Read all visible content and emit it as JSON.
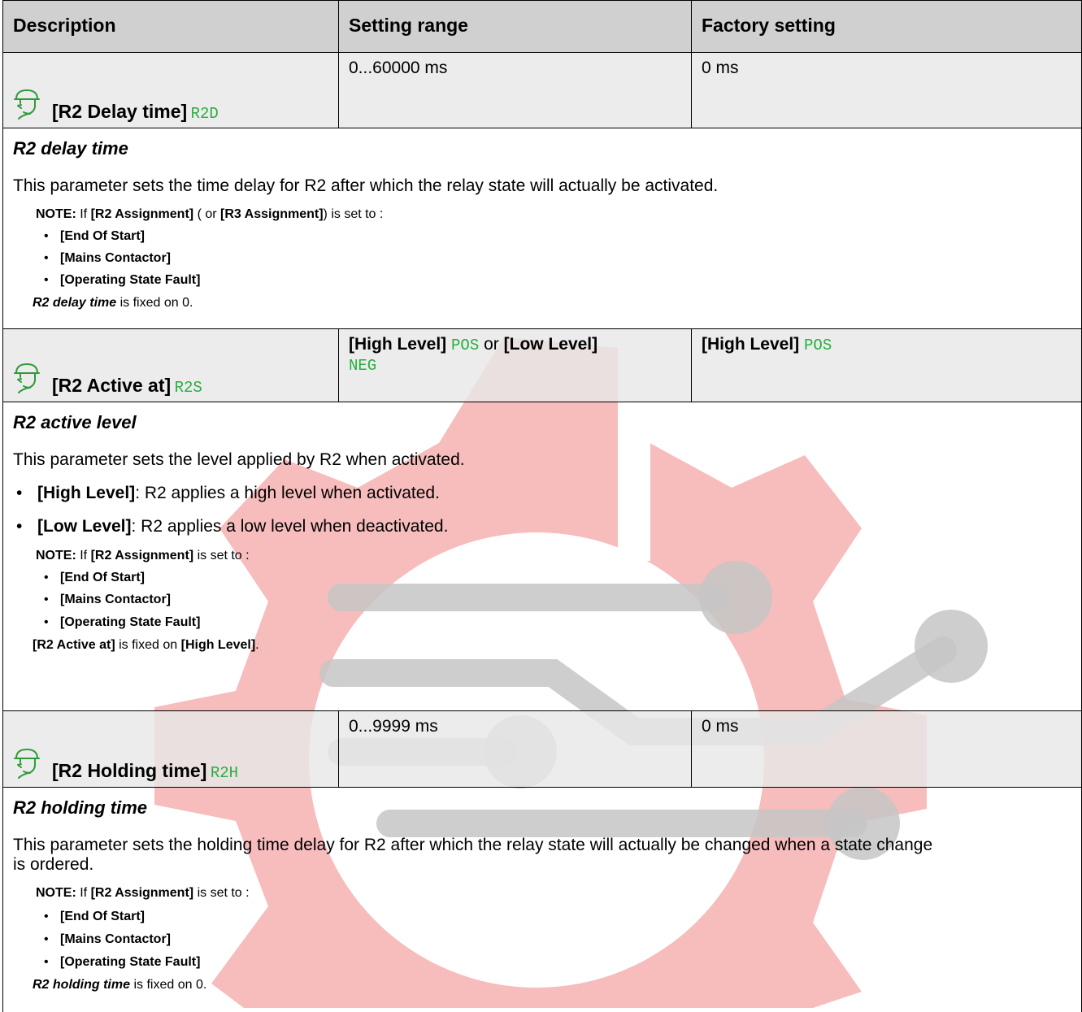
{
  "table": {
    "headers": [
      "Description",
      "Setting range",
      "Factory setting"
    ]
  },
  "params": [
    {
      "name": "[R2 Delay time]",
      "code": "R2D",
      "range": "0...60000 ms",
      "factory": "0 ms",
      "desc_title": "R2 delay time",
      "desc_text": "This parameter sets the time delay for R2 after which the relay state will actually be activated.",
      "note_label": "NOTE:",
      "note_if": "If",
      "note_a": "[R2 Assignment]",
      "note_mid": "( or",
      "note_b": "[R3 Assignment]",
      "note_end": ") is set to :",
      "note_items": [
        "[End Of Start]",
        "[Mains Contactor]",
        "[Operating State Fault]"
      ],
      "fixed_subject": "R2 delay time",
      "fixed_text": "is fixed on 0."
    },
    {
      "name": "[R2 Active at]",
      "code": "R2S",
      "range_a": "[High Level]",
      "range_a_code": "POS",
      "range_or": "or",
      "range_b": "[Low Level]",
      "range_b_code": "NEG",
      "factory_a": "[High Level]",
      "factory_code": "POS",
      "desc_title": "R2 active level",
      "desc_text": "This parameter sets the level applied by R2 when activated.",
      "bullets": [
        {
          "label": "[High Level]",
          "text": ": R2 applies a high level when activated."
        },
        {
          "label": "[Low Level]",
          "text": ": R2 applies a low level when deactivated."
        }
      ],
      "note_label": "NOTE:",
      "note_if": "If",
      "note_a": "[R2 Assignment]",
      "note_end": "is set to :",
      "note_items": [
        "[End Of Start]",
        "[Mains Contactor]",
        "[Operating State Fault]"
      ],
      "fixed_subject": "[R2 Active at]",
      "fixed_text": "is fixed on",
      "fixed_value": "[High Level]",
      "fixed_dot": "."
    },
    {
      "name": "[R2 Holding time]",
      "code": "R2H",
      "range": "0...9999 ms",
      "factory": "0 ms",
      "desc_title": "R2 holding time",
      "desc_text": "This parameter sets the holding time delay for R2 after which the relay state will actually be changed when a state change is ordered.",
      "note_label": "NOTE:",
      "note_if": "If",
      "note_a": "[R2 Assignment]",
      "note_end": "is set to :",
      "note_items": [
        "[End Of Start]",
        "[Mains Contactor]",
        "[Operating State Fault]"
      ],
      "fixed_subject": "R2 holding time",
      "fixed_text": "is fixed on 0."
    }
  ],
  "icons": {
    "expert": "expert-user-head-icon",
    "watermark": "gear-circuit-watermark"
  },
  "colors": {
    "code_green": "#27ae3f",
    "header_bg": "#d0d0d0",
    "param_row_bg": "#e8e8e8",
    "watermark_red": "#f6b3b3",
    "watermark_gray": "#c6c6c6"
  }
}
